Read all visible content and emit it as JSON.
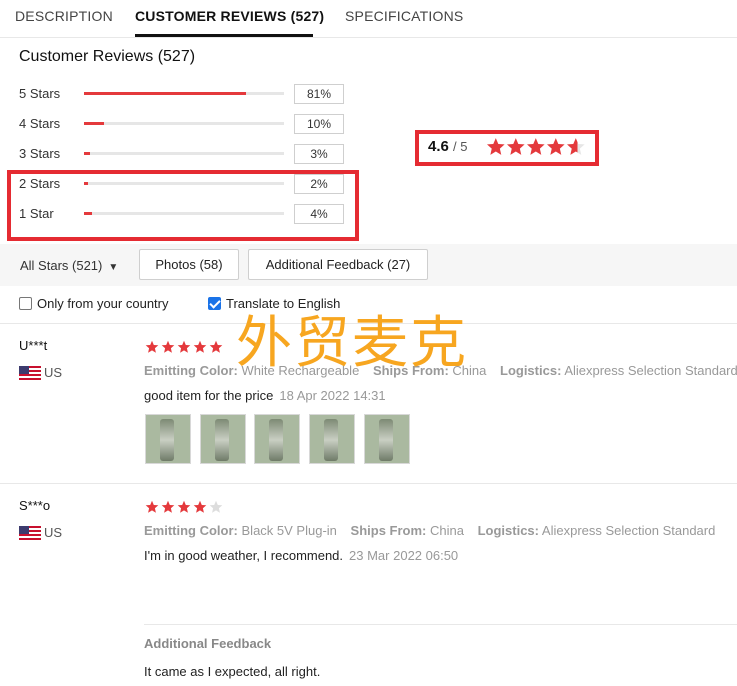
{
  "tabs": [
    {
      "label": "DESCRIPTION"
    },
    {
      "label": "CUSTOMER REVIEWS (527)"
    },
    {
      "label": "SPECIFICATIONS"
    }
  ],
  "summary": {
    "title": "Customer Reviews (527)",
    "average": "4.6",
    "out_of": "/ 5",
    "average_value": 4.6,
    "rows": [
      {
        "label": "5 Stars",
        "pct": "81%",
        "fraction": 0.81
      },
      {
        "label": "4 Stars",
        "pct": "10%",
        "fraction": 0.1
      },
      {
        "label": "3 Stars",
        "pct": "3%",
        "fraction": 0.03
      },
      {
        "label": "2 Stars",
        "pct": "2%",
        "fraction": 0.02
      },
      {
        "label": "1 Star",
        "pct": "4%",
        "fraction": 0.04
      }
    ]
  },
  "filters": {
    "all_stars": "All Stars (521)",
    "photos": "Photos (58)",
    "feedback": "Additional Feedback (27)",
    "only_country": "Only from your country",
    "translate": "Translate to English",
    "translate_checked": true
  },
  "watermark": "外贸麦克",
  "reviews": [
    {
      "user": "U***t",
      "country": "US",
      "rating": 5,
      "emitting_key": "Emitting Color:",
      "emitting_val": "White Rechargeable",
      "ships_key": "Ships From:",
      "ships_val": "China",
      "logistics_key": "Logistics:",
      "logistics_val": "Aliexpress Selection Standard",
      "comment": "good item for the price",
      "date": "18 Apr 2022 14:31"
    },
    {
      "user": "S***o",
      "country": "US",
      "rating": 4,
      "emitting_key": "Emitting Color:",
      "emitting_val": "Black 5V Plug-in",
      "ships_key": "Ships From:",
      "ships_val": "China",
      "logistics_key": "Logistics:",
      "logistics_val": "Aliexpress Selection Standard",
      "comment": "I'm in good weather, I recommend.",
      "date": "23 Mar 2022 06:50",
      "additional_feedback_title": "Additional Feedback",
      "additional_feedback": "It came as I expected, all right."
    }
  ],
  "colors": {
    "accent_red": "#e4393c",
    "highlight_red": "#e52b32",
    "watermark_orange": "#f7a620",
    "checkbox_blue": "#1a73e8"
  }
}
